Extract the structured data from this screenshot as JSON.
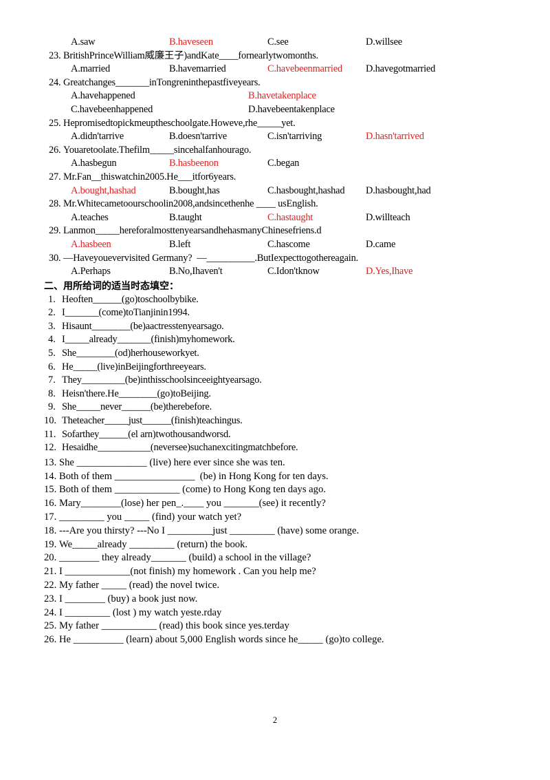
{
  "document": {
    "page_number": "2",
    "accent_red": "#e02020"
  },
  "orphan_option_row": {
    "options": [
      "A.saw",
      "B.haveseen",
      "C.see",
      "D.willsee"
    ],
    "correct_index": 1
  },
  "multiple_choice": [
    {
      "number": "23.",
      "stem": "BritishPrinceWilliam威廉王子)andKate____fornearlytwomonths.",
      "layout": "cols4",
      "options": [
        "A.married",
        "B.havemarried",
        "C.havebeenmarried",
        "D.havegotmarried"
      ],
      "correct_index": 2
    },
    {
      "number": "24.",
      "stem": "Greatchanges_______inTongreninthepastfiveyears.",
      "layout": "cols2",
      "options": [
        "A.havehappened",
        "B.havetakenplace",
        "C.havebeenhappened",
        "D.havebeentakenplace"
      ],
      "correct_index": 1
    },
    {
      "number": "25.",
      "stem": "Hepromisedtopickmeuptheschoolgate.Howeve,rhe_____yet.",
      "layout": "cols4",
      "options": [
        "A.didn'tarrive",
        "B.doesn'tarrive",
        "C.isn'tarriving",
        "D.hasn'tarrived"
      ],
      "correct_index": 3
    },
    {
      "number": "26.",
      "stem": "Youaretoolate.Thefilm_____sincehalfanhourago.",
      "layout": "cols3",
      "options": [
        "A.hasbegun",
        "B.hasbeenon",
        "C.began"
      ],
      "correct_index": 1
    },
    {
      "number": "27.",
      "stem": "Mr.Fan__thiswatchin2005.He___itfor6years.",
      "layout": "cols4",
      "options": [
        "A.bought,hashad",
        "B.bought,has",
        "C.hasbought,hashad",
        "D.hasbought,had"
      ],
      "correct_index": 0
    },
    {
      "number": "28.",
      "stem": "Mr.Whitecametoourschoolin2008,andsincethenhe ____ usEnglish.",
      "layout": "cols4",
      "options": [
        "A.teaches",
        "B.taught",
        "C.hastaught",
        "D.willteach"
      ],
      "correct_index": 2
    },
    {
      "number": "29.",
      "stem": "Lanmon_____hereforalmosttenyearsandhehasmanyChinesefriens.d",
      "layout": "cols4",
      "options": [
        "A.hasbeen",
        "B.left",
        "C.hascome",
        "D.came"
      ],
      "correct_index": 0
    },
    {
      "number": "30.",
      "stem": "—Haveyouevervisited Germany?  —__________.ButIexpecttogothereagain.",
      "layout": "cols4",
      "options": [
        "A.Perhaps",
        "B.No,Ihaven't",
        "C.Idon'tknow",
        "D.Yes,Ihave"
      ],
      "correct_index": 3
    }
  ],
  "section_two": {
    "heading": "二、用所给词的适当时态填空：",
    "items_condensed": [
      {
        "number": "1.",
        "text": "Heoften______(go)toschoolbybike."
      },
      {
        "number": "2.",
        "text": "I_______(come)toTianjinin1994."
      },
      {
        "number": "3.",
        "text": "Hisaunt________(be)aactresstenyearsago."
      },
      {
        "number": "4.",
        "text": "I_____already_______(finish)myhomework."
      },
      {
        "number": "5.",
        "text": "She________(od)herhouseworkyet."
      },
      {
        "number": "6.",
        "text": "He_____(live)inBeijingforthreeyears."
      },
      {
        "number": "7.",
        "text": "They_________(be)inthisschoolsinceeightyearsago."
      },
      {
        "number": "8.",
        "text": "Heisn'there.He________(go)toBeijing."
      },
      {
        "number": "9.",
        "text": "She_____never______(be)therebefore."
      },
      {
        "number": "10.",
        "text": "Theteacher_____just______(finish)teachingus."
      },
      {
        "number": "11.",
        "text": "Sofarthey______(el arn)twothousandworsd."
      },
      {
        "number": "12.",
        "text": "Hesaidhe___________(neversee)suchanexcitingmatchbefore."
      }
    ],
    "items_loose": [
      {
        "number": "13.",
        "text": "She ______________ (live) here ever since she was ten."
      },
      {
        "number": "14.",
        "text": "Both of them ________________  (be) in Hong Kong for ten days."
      },
      {
        "number": "15.",
        "text": "Both of them _____________ (come) to Hong Kong ten days ago."
      },
      {
        "number": "16.",
        "text": "Mary________(lose) her pen_.____ you _______(see) it recently?"
      },
      {
        "number": "17.",
        "text": "_________ you _____ (find) your watch yet?"
      },
      {
        "number": "18.",
        "text": "---Are you thirsty? ---No I _________just _________ (have) some orange."
      },
      {
        "number": "19.",
        "text": "We_____already _________ (return) the book."
      },
      {
        "number": "20.",
        "text": "________ they already_______ (build) a school in the village?"
      },
      {
        "number": "21.",
        "text": "I _____________(not finish) my homework . Can you help me?"
      },
      {
        "number": "22.",
        "text": "My father _____ (read) the novel twice."
      },
      {
        "number": "23.",
        "text": "I ________ (buy) a book just now."
      },
      {
        "number": "24.",
        "text": "I _________ (lost ) my watch yeste.rday"
      },
      {
        "number": "25.",
        "text": "My father ___________ (read) this book since yes.terday"
      },
      {
        "number": "26.",
        "text": "He __________ (learn) about 5,000 English words since he_____ (go)to college."
      }
    ]
  }
}
